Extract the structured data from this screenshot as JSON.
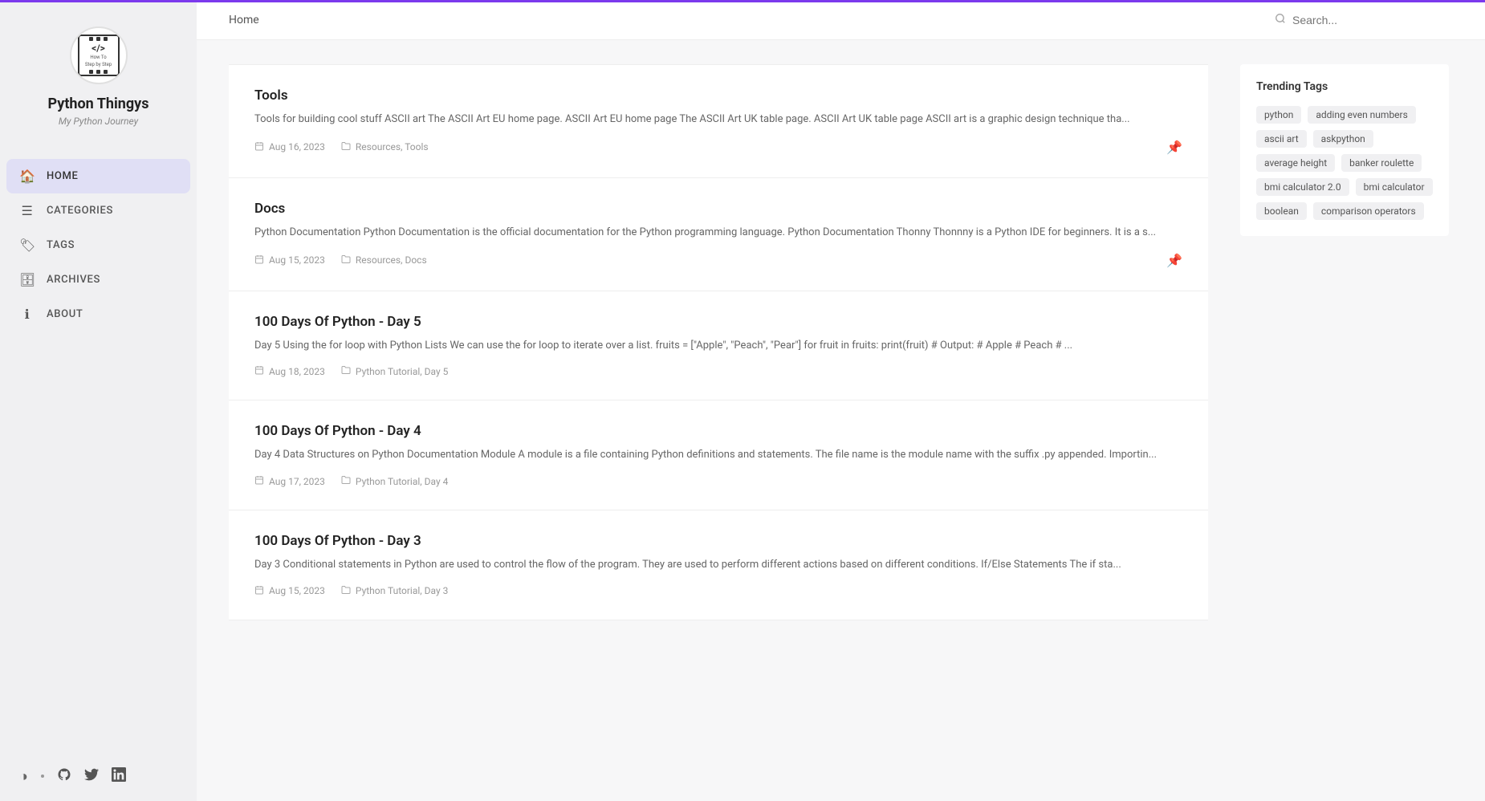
{
  "site": {
    "title": "Python Thingys",
    "subtitle": "My Python Journey",
    "logo_code": "</>",
    "logo_label": "How To",
    "logo_sublabel": "Step by Step"
  },
  "topbar_accent_color": "#7c3aed",
  "topnav": {
    "links": [
      {
        "label": "Home",
        "href": "#"
      }
    ],
    "search_placeholder": "Search..."
  },
  "sidebar": {
    "nav_items": [
      {
        "id": "home",
        "label": "HOME",
        "icon": "🏠",
        "active": true
      },
      {
        "id": "categories",
        "label": "CATEGORIES",
        "icon": "☰",
        "active": false
      },
      {
        "id": "tags",
        "label": "TAGS",
        "icon": "🏷",
        "active": false
      },
      {
        "id": "archives",
        "label": "ARCHIVES",
        "icon": "🗄",
        "active": false
      },
      {
        "id": "about",
        "label": "ABOUT",
        "icon": "ℹ",
        "active": false
      }
    ],
    "footer_icons": [
      {
        "id": "theme-toggle",
        "icon": "◑"
      },
      {
        "id": "github",
        "icon": "⬤"
      },
      {
        "id": "twitter",
        "icon": "𝕏"
      },
      {
        "id": "linkedin",
        "icon": "in"
      }
    ]
  },
  "posts": [
    {
      "id": "tools",
      "title": "Tools",
      "excerpt": "Tools for building cool stuff ASCII art The ASCII Art EU home page. ASCII Art EU home page The ASCII Art UK table page. ASCII Art UK table page ASCII art is a graphic design technique tha...",
      "date": "Aug 16, 2023",
      "categories": "Resources, Tools",
      "pinned": true
    },
    {
      "id": "docs",
      "title": "Docs",
      "excerpt": "Python Documentation Python Documentation is the official documentation for the Python programming language. Python Documentation Thonny Thonnny is a Python IDE for beginners. It is a s...",
      "date": "Aug 15, 2023",
      "categories": "Resources, Docs",
      "pinned": true
    },
    {
      "id": "100-days-day5",
      "title": "100 Days Of Python - Day 5",
      "excerpt": "Day 5 Using the for loop with Python Lists We can use the for loop to iterate over a list. fruits = [\"Apple\", \"Peach\", \"Pear\"] for fruit in fruits: print(fruit) # Output: # Apple # Peach # ...",
      "date": "Aug 18, 2023",
      "categories": "Python Tutorial, Day 5",
      "pinned": false
    },
    {
      "id": "100-days-day4",
      "title": "100 Days Of Python - Day 4",
      "excerpt": "Day 4 Data Structures on Python Documentation Module A module is a file containing Python definitions and statements. The file name is the module name with the suffix .py appended. Importin...",
      "date": "Aug 17, 2023",
      "categories": "Python Tutorial, Day 4",
      "pinned": false
    },
    {
      "id": "100-days-day3",
      "title": "100 Days Of Python - Day 3",
      "excerpt": "Day 3 Conditional statements in Python are used to control the flow of the program. They are used to perform different actions based on different conditions. If/Else Statements The if sta...",
      "date": "Aug 15, 2023",
      "categories": "Python Tutorial, Day 3",
      "pinned": false
    }
  ],
  "trending_tags": {
    "title": "Trending Tags",
    "tags": [
      "python",
      "adding even numbers",
      "ascii art",
      "askpython",
      "average height",
      "banker roulette",
      "bmi calculator 2.0",
      "bmi calculator",
      "boolean",
      "comparison operators"
    ]
  }
}
